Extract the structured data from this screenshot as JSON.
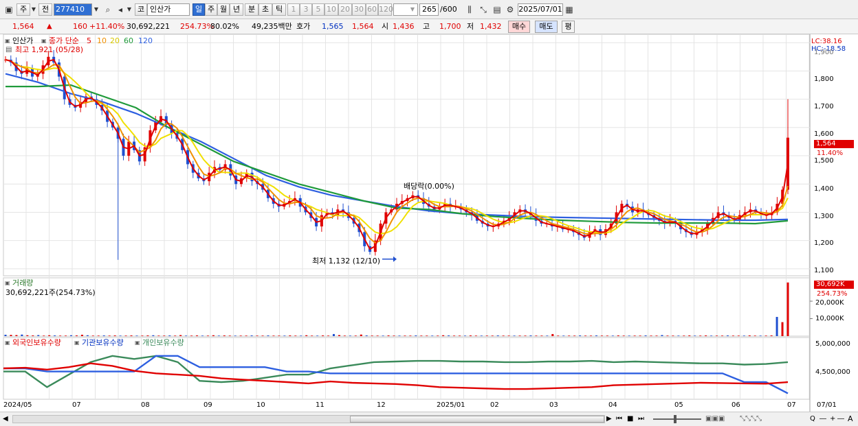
{
  "toolbar": {
    "market_type": "주",
    "prev_label": "전",
    "code": "277410",
    "code_type": "코",
    "name": "인산가",
    "periods": [
      "일",
      "주",
      "월",
      "년",
      "분",
      "초",
      "틱"
    ],
    "selected_period": "일",
    "intervals": [
      "1",
      "3",
      "5",
      "10",
      "20",
      "30",
      "60",
      "120"
    ],
    "count": "265",
    "count_max": "/600",
    "date": "2025/07/01"
  },
  "info": {
    "price": "1,564",
    "change": "160",
    "change_pct": "+11.40%",
    "volume": "30,692,221",
    "volume_ratio": "254.73%",
    "turnover_pct": "80.02%",
    "amount": "49,235백만",
    "quote_label": "호가",
    "ask": "1,565",
    "bid": "1,564",
    "open_label": "시",
    "open": "1,436",
    "high_label": "고",
    "high": "1,700",
    "low_label": "저",
    "low": "1,432",
    "buy_label": "매수",
    "sell_label": "매도",
    "eval_label": "평"
  },
  "legend": {
    "name": "인산가",
    "ma_label": "종가 단순",
    "ma_periods": [
      "5",
      "10",
      "20",
      "60",
      "120"
    ],
    "ma_colors": [
      "#e00000",
      "#f09000",
      "#f0e000",
      "#1f9a3a",
      "#2d5fe0"
    ],
    "high_note": "최고 1,921 (05/28)",
    "low_note": "최저 1,132 (12/10)",
    "dividend_note": "배당락(0.00%)"
  },
  "scale": {
    "lc": "LC:38.16",
    "hc": "HC:-18.58",
    "price_ticks": [
      "1,900",
      "1,800",
      "1,700",
      "1,600",
      "1,500",
      "1,400",
      "1,300",
      "1,200",
      "1,100"
    ],
    "current_price": "1,564",
    "current_pct": "11.40%",
    "volume_badge": "30,692K",
    "volume_pct": "254.73%",
    "volume_ticks": [
      "20,000K",
      "10,000K"
    ],
    "holding_ticks": [
      "5,000,000",
      "4,500,000"
    ],
    "x_ticks": [
      "2024/05",
      "07",
      "08",
      "09",
      "10",
      "11",
      "12",
      "2025/01",
      "02",
      "03",
      "04",
      "05",
      "06",
      "07",
      "07/01"
    ]
  },
  "volume_panel": {
    "title": "거래량",
    "value": "30,692,221주(254.73%)"
  },
  "holding_panel": {
    "series": [
      "외국인보유수량",
      "기관보유수량",
      "개인보유수량"
    ],
    "colors": [
      "#e00000",
      "#2d5fe0",
      "#3a8a5a"
    ]
  },
  "chart_data": {
    "type": "line",
    "price_range": [
      1090,
      1920
    ],
    "candles_close": [
      1840,
      1830,
      1800,
      1790,
      1810,
      1780,
      1790,
      1820,
      1850,
      1830,
      1780,
      1700,
      1680,
      1670,
      1690,
      1710,
      1700,
      1680,
      1660,
      1620,
      1600,
      1560,
      1500,
      1550,
      1520,
      1480,
      1530,
      1590,
      1620,
      1640,
      1610,
      1580,
      1560,
      1520,
      1470,
      1440,
      1420,
      1410,
      1440,
      1460,
      1450,
      1470,
      1430,
      1400,
      1420,
      1440,
      1410,
      1400,
      1380,
      1350,
      1330,
      1320,
      1330,
      1340,
      1350,
      1320,
      1300,
      1280,
      1250,
      1290,
      1300,
      1290,
      1310,
      1300,
      1280,
      1260,
      1230,
      1180,
      1160,
      1200,
      1260,
      1300,
      1310,
      1330,
      1340,
      1350,
      1360,
      1350,
      1330,
      1320,
      1310,
      1320,
      1330,
      1320,
      1320,
      1310,
      1300,
      1290,
      1270,
      1260,
      1250,
      1250,
      1260,
      1270,
      1280,
      1300,
      1310,
      1300,
      1290,
      1270,
      1260,
      1260,
      1250,
      1250,
      1240,
      1240,
      1230,
      1220,
      1210,
      1230,
      1240,
      1220,
      1240,
      1260,
      1300,
      1330,
      1320,
      1300,
      1310,
      1300,
      1290,
      1280,
      1270,
      1260,
      1270,
      1260,
      1240,
      1230,
      1220,
      1230,
      1240,
      1260,
      1280,
      1300,
      1290,
      1280,
      1270,
      1290,
      1300,
      1310,
      1300,
      1290,
      1290,
      1300,
      1330,
      1380,
      1564
    ],
    "ma120": [
      1790,
      1760,
      1720,
      1690,
      1650,
      1600,
      1550,
      1490,
      1430,
      1390,
      1360,
      1340,
      1320,
      1305,
      1295,
      1290,
      1285,
      1282,
      1280,
      1278,
      1276,
      1274,
      1272,
      1272,
      1275
    ],
    "ma60": [
      1745,
      1745,
      1750,
      1710,
      1670,
      1600,
      1540,
      1480,
      1440,
      1400,
      1370,
      1340,
      1315,
      1310,
      1295,
      1285,
      1278,
      1272,
      1268,
      1264,
      1262,
      1262,
      1262,
      1260,
      1270
    ],
    "volume_k": [
      800,
      700,
      600,
      900,
      500,
      400,
      600,
      300,
      500,
      400,
      300,
      300,
      500,
      400,
      800,
      500,
      300,
      300,
      400,
      300,
      400,
      300,
      300,
      400,
      300,
      300,
      400,
      500,
      300,
      300,
      400,
      300,
      600,
      300,
      300,
      400,
      300,
      300,
      500,
      300,
      400,
      300,
      300,
      300,
      300,
      400,
      300,
      300,
      400,
      300,
      300,
      300,
      400,
      300,
      300,
      500,
      300,
      300,
      400,
      300,
      1200,
      600,
      300,
      300,
      300,
      900,
      400,
      300,
      300,
      300,
      400,
      300,
      300,
      300,
      300,
      400,
      300,
      300,
      300,
      300,
      500,
      400,
      300,
      300,
      300,
      400,
      300,
      300,
      300,
      300,
      400,
      300,
      300,
      300,
      300,
      300,
      400,
      300,
      300,
      300,
      1200,
      300,
      300,
      300,
      300,
      400,
      300,
      300,
      400,
      300,
      300,
      300,
      400,
      300,
      300,
      300,
      300,
      400,
      300,
      300,
      600,
      300,
      300,
      300,
      300,
      400,
      300,
      300,
      400,
      300,
      300,
      300,
      400,
      300,
      300,
      300,
      400,
      300,
      300,
      300,
      400,
      11000,
      8000,
      30692
    ],
    "foreign": [
      4600,
      4610,
      4580,
      4620,
      4680,
      4640,
      4560,
      4520,
      4500,
      4480,
      4440,
      4420,
      4400,
      4380,
      4360,
      4390,
      4370,
      4360,
      4350,
      4330,
      4300,
      4290,
      4280,
      4270,
      4270,
      4280,
      4290,
      4300,
      4330,
      4340,
      4350,
      4360,
      4370,
      4365,
      4360,
      4355,
      4380
    ],
    "institution": [
      4600,
      4600,
      4550,
      4550,
      4550,
      4550,
      4550,
      4800,
      4800,
      4620,
      4620,
      4620,
      4620,
      4550,
      4550,
      4520,
      4520,
      4520,
      4520,
      4520,
      4520,
      4520,
      4520,
      4520,
      4520,
      4520,
      4520,
      4520,
      4520,
      4520,
      4520,
      4520,
      4520,
      4520,
      4380,
      4380,
      4200
    ],
    "individual": [
      4550,
      4550,
      4300,
      4500,
      4700,
      4800,
      4750,
      4800,
      4700,
      4400,
      4380,
      4400,
      4450,
      4500,
      4500,
      4600,
      4650,
      4700,
      4710,
      4720,
      4720,
      4710,
      4710,
      4700,
      4700,
      4710,
      4710,
      4720,
      4700,
      4710,
      4700,
      4690,
      4680,
      4680,
      4660,
      4670,
      4700
    ]
  }
}
